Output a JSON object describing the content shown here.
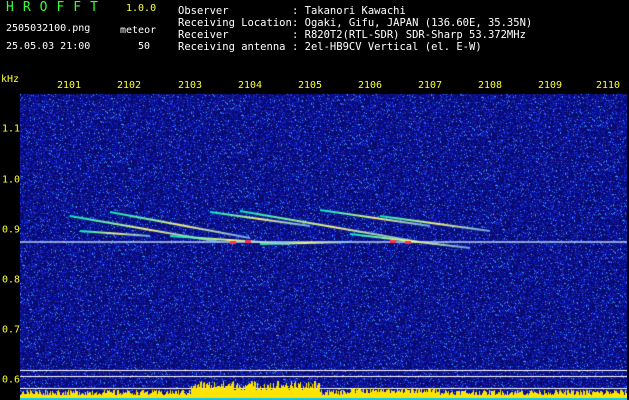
{
  "header": {
    "logo": "HROFFT",
    "version": "1.0.0",
    "filename": "2505032100.png",
    "target_label": "meteor",
    "datetime": "25.05.03 21:00",
    "count": "50",
    "meta": [
      {
        "key": "Observer",
        "value": ": Takanori Kawachi"
      },
      {
        "key": "Receiving Location",
        "value": ": Ogaki, Gifu, JAPAN (136.60E, 35.35N)"
      },
      {
        "key": "Receiver",
        "value": ": R820T2(RTL-SDR) SDR-Sharp 53.372MHz"
      },
      {
        "key": "Receiving antenna",
        "value": ": 2el-HB9CV Vertical (el. E-W)"
      }
    ]
  },
  "axis": {
    "unit": "kHz",
    "x_ticks": [
      "2101",
      "2102",
      "2103",
      "2104",
      "2105",
      "2106",
      "2107",
      "2108",
      "2109",
      "2110"
    ],
    "y_ticks": [
      "1.1",
      "1.0",
      "0.9",
      "0.8",
      "0.7",
      "0.6"
    ]
  },
  "colors": {
    "background": "#000000",
    "spectrogram_noise": "#10108a",
    "text_green": "#33ff33",
    "text_yellow": "#ffff33",
    "signal_line": "#c8e6ff",
    "bars_yellow": "#ffe400",
    "bars_cyan": "#00c8ff"
  }
}
